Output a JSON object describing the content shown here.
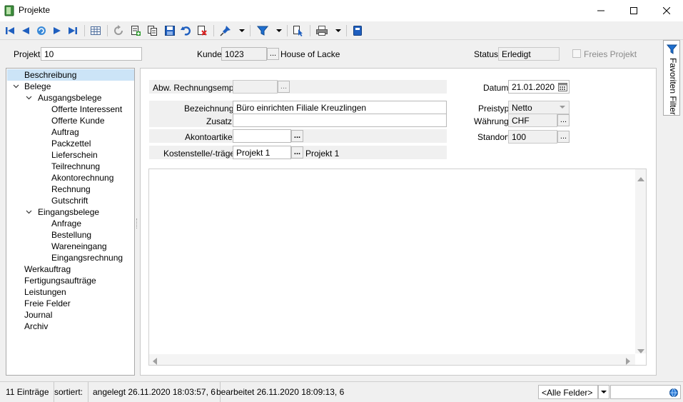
{
  "window": {
    "title": "Projekte",
    "app_icon": "book-icon"
  },
  "toolbar": {
    "icons": [
      "first-record-icon",
      "prev-record-icon",
      "back-icon",
      "next-record-icon",
      "last-record-icon",
      "table-view-icon",
      "refresh-icon",
      "new-record-icon",
      "copy-icon",
      "save-icon",
      "undo-icon",
      "delete-icon",
      "pin-icon",
      "filter-icon",
      "select-icon",
      "print-icon",
      "bookmark-icon"
    ]
  },
  "header": {
    "projekt_label": "Projekt",
    "projekt_value": "10",
    "kunde_label": "Kunde",
    "kunde_value": "1023",
    "kunde_name": "House of Lacke",
    "status_label": "Status",
    "status_value": "Erledigt",
    "freies_projekt_label": "Freies Projekt",
    "dots": "..."
  },
  "tree": {
    "items": [
      {
        "label": "Beschreibung"
      },
      {
        "label": "Belege"
      },
      {
        "label": "Ausgangsbelege"
      },
      {
        "label": "Offerte Interessent"
      },
      {
        "label": "Offerte Kunde"
      },
      {
        "label": "Auftrag"
      },
      {
        "label": "Packzettel"
      },
      {
        "label": "Lieferschein"
      },
      {
        "label": "Teilrechnung"
      },
      {
        "label": "Akontorechnung"
      },
      {
        "label": "Rechnung"
      },
      {
        "label": "Gutschrift"
      },
      {
        "label": "Eingangsbelege"
      },
      {
        "label": "Anfrage"
      },
      {
        "label": "Bestellung"
      },
      {
        "label": "Wareneingang"
      },
      {
        "label": "Eingangsrechnung"
      },
      {
        "label": "Werkauftrag"
      },
      {
        "label": "Fertigungsaufträge"
      },
      {
        "label": "Leistungen"
      },
      {
        "label": "Freie Felder"
      },
      {
        "label": "Journal"
      },
      {
        "label": "Archiv"
      }
    ]
  },
  "form": {
    "abw_label": "Abw. Rechnungsempf.",
    "abw_value": "",
    "bezeichnung_label": "Bezeichnung",
    "bezeichnung_value": "Büro einrichten Filiale Kreuzlingen",
    "zusatz_label": "Zusatz",
    "zusatz_value": "",
    "akonto_label": "Akontoartikel",
    "akonto_value": "",
    "kst_label": "Kostenstelle/-träger",
    "kst_value": "Projekt 1",
    "kst_name": "Projekt 1",
    "datum_label": "Datum",
    "datum_value": "21.01.2020",
    "preistyp_label": "Preistyp",
    "preistyp_value": "Netto",
    "waehrung_label": "Währung",
    "waehrung_value": "CHF",
    "standort_label": "Standort",
    "standort_value": "100"
  },
  "sidetab": {
    "label": "Favoriten Filter"
  },
  "statusbar": {
    "count": "11 Einträge",
    "sorted": "sortiert:",
    "created": "angelegt 26.11.2020 18:03:57,  6",
    "edited": "bearbeitet 26.11.2020 18:09:13,  6",
    "field_select": "<Alle Felder>",
    "search_value": ""
  }
}
